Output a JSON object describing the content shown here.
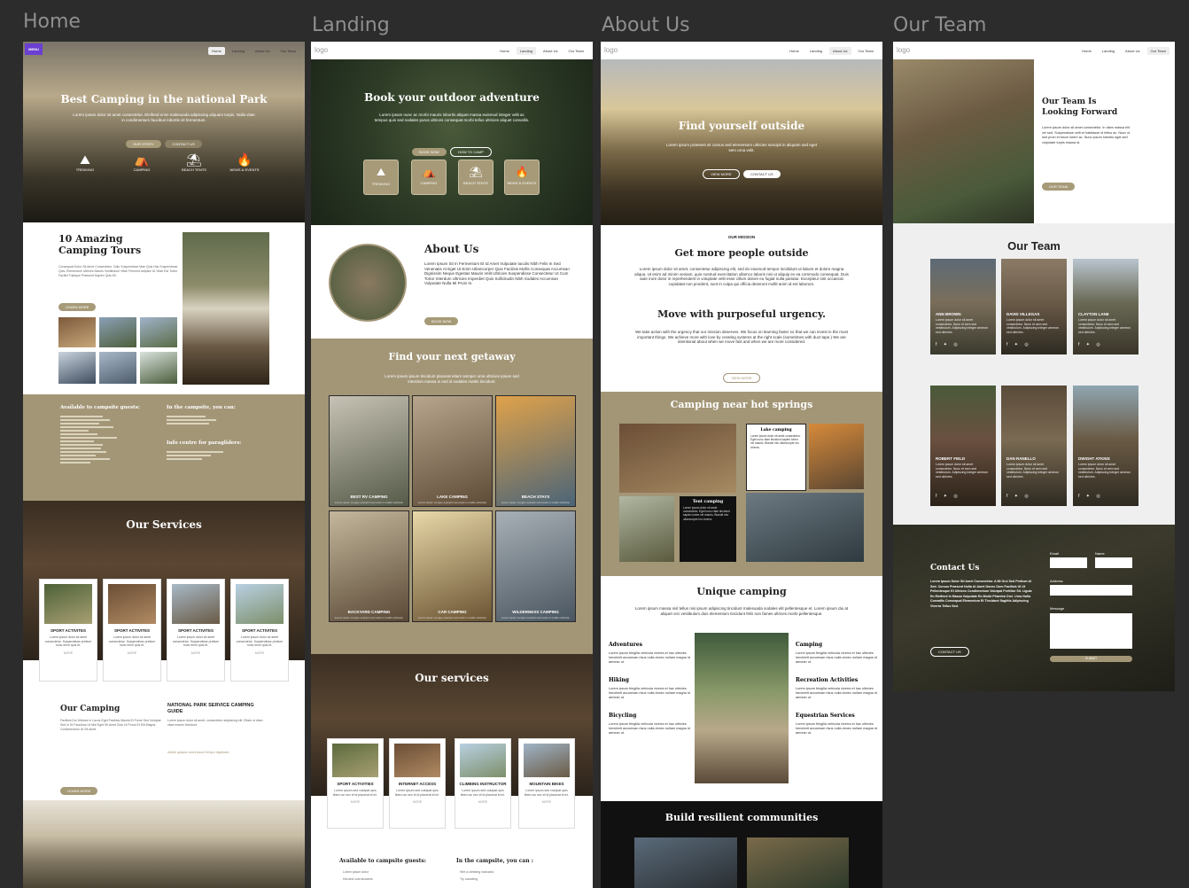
{
  "canvas": {
    "bg": "#2c2c2c",
    "olive": "#a39677",
    "dark": "#1f1f1f"
  },
  "frames": {
    "home": {
      "title": "Home",
      "logo": "MENU",
      "nav": [
        "Home",
        "Landing",
        "About Us",
        "Our Team"
      ],
      "hero_title": "Best Camping in the national Park",
      "hero_text": "Lorem ipsum dolor sit amet consectetur. Eleifend enim malesuada adipiscing aliquam turpis. Nulla vitae in condimentum faucibus lobortis sit fermentum.",
      "hero_btn1": "OUR STORY",
      "hero_btn2": "CONTACT US",
      "hero_icons": [
        {
          "icon": "mountain-icon",
          "label": "TREKKING"
        },
        {
          "icon": "tent-icon",
          "label": "CAMPING"
        },
        {
          "icon": "beach-icon",
          "label": "BEACH TENTS"
        },
        {
          "icon": "fire-icon",
          "label": "NEWS & EVENTS"
        }
      ],
      "tours_title": "10 Amazing Camping Tours",
      "tours_text": "Consequat Dolor Sit Amet Consectetur. Odio Suspendisse Mae Quis Hac Suspendisse Quis. Elementum Ultrices Mauris Vestibulum Vitae Ferment Adipisci Ut Vitae Est Tortor Facilisi Tristique Praesent Sapien Quis Mi.",
      "learn_more": "LEARN MORE",
      "guests_title": "Available to campsite guests:",
      "guests_items": [
        "Lorem ipsum dolor",
        "Hot and cold showers",
        "Kitchen facilities",
        "Barbecue area",
        "Laundry",
        "Drinking water",
        "Parking",
        "Wifi access",
        "Shop",
        "Games area",
        "Bike hire",
        "Picnic tables",
        "Night lighting",
        "Playground"
      ],
      "inthecamp_title": "In the campsite, you can:",
      "inthecamp_items": [
        "Hire a climbing instructor",
        "Go horse riding",
        "Try canoeing"
      ],
      "info_title": "Info centre for paragliders:",
      "info_items": [
        "Weather reports",
        "Flight routes",
        "Landing zones"
      ],
      "services_title": "Our Services",
      "service_cards": [
        {
          "title": "SPORT ACTIVITES",
          "text": "Lorem ipsum dolor sit amet consectetur. Suspendisse pretium nunc enim quis et.",
          "more": "MORE"
        },
        {
          "title": "SPORT ACTIVITES",
          "text": "Lorem ipsum dolor sit amet consectetur. Suspendisse pretium nunc enim quis et.",
          "more": "MORE"
        },
        {
          "title": "SPORT ACTIVITES",
          "text": "Lorem ipsum dolor sit amet consectetur. Suspendisse pretium nunc enim quis et.",
          "more": "MORE"
        },
        {
          "title": "SPORT ACTIVITES",
          "text": "Lorem ipsum dolor sit amet consectetur. Suspendisse pretium nunc enim quis et.",
          "more": "MORE"
        }
      ],
      "our_camping_title": "Our Camping",
      "our_camping_text": "Facilisis Dui Ultrices In Lacus Eget Facilisis Mauris Et Tortor Sed Volutpat Sed In Et Faucibus Ut Nisl Eget Sit Amet Duis Ut Purus Et Elit Magna Condimentum Ut Sit Amet.",
      "guide_title": "NATIONAL PARK SERVICE CAMPING GUIDE",
      "guide_text": "Lorem ipsum dolor sit amet, consectetur adipiscing elit. Etiam ut diam vitae mauris tincidunt.",
      "guide_highlight": "Article quisque amet ipsum tempor dignissim.",
      "learn_more2": "LEARN MORE"
    },
    "landing": {
      "title": "Landing",
      "logo": "logo",
      "nav": [
        "Home",
        "Landing",
        "About Us",
        "Our Team"
      ],
      "hero_title": "Book your outdoor adventure",
      "hero_text": "Lorem ipsum nunc ac morbi mauris lobortis aliquet massa euismod integer velit ac tempus quis sed sodales purus ultrices consequat morbi tellus ultricies aliquet convallis.",
      "btn1": "BOOK NOW",
      "btn2": "HOW TO CAMP",
      "icons": [
        {
          "icon": "mountain-icon",
          "label": "TREKKING"
        },
        {
          "icon": "tent-icon",
          "label": "CAMPING"
        },
        {
          "icon": "beach-icon",
          "label": "BEACH TENTS"
        },
        {
          "icon": "fire-icon",
          "label": "NEWS & EVENTS"
        }
      ],
      "about_title": "About Us",
      "about_text": "Lorem Ipsum Sit In Fermentum Et Id Amet Vulputate Iaculis Nibh Felis In Sed Venenatis At Eget Ut Enim Ullamcorper Quis Facilisis Mollis Consequat Accumsan Dignissim Neque Egestas Mauris Velit Ultricies Suspendisse Consectetur Ut Cum Tortor Interdum Ultricies Imperdiet Quis Sollicitudin Nibh Sodales Accumsan Vulputate Nulla Mi Proin In.",
      "about_btn": "BOOK NOW",
      "getaway_title": "Find your next getaway",
      "getaway_text": "Lorem ipsum ipsum tincidunt placerat etiam semper urna ultricies ipsum sed interdum massa in sed id sodales mattis tincidunt.",
      "getaway": [
        {
          "label": "BEST RV CAMPING",
          "sub": "Lorem ipsum congue suscipit commodo in mattis vehicula."
        },
        {
          "label": "LAKE CAMPING",
          "sub": "Lorem ipsum congue suscipit commodo in mattis vehicula."
        },
        {
          "label": "BEACH STAYS",
          "sub": "Lorem ipsum congue suscipit commodo in mattis vehicula."
        },
        {
          "label": "BACKYARD CAMPING",
          "sub": "Lorem ipsum congue suscipit commodo in mattis vehicula."
        },
        {
          "label": "CAR CAMPING",
          "sub": "Lorem ipsum congue suscipit commodo in mattis vehicula."
        },
        {
          "label": "WILDERNESS CAMPING",
          "sub": "Lorem ipsum congue suscipit commodo in mattis vehicula."
        }
      ],
      "services_title": "Our services",
      "service_cards": [
        {
          "title": "SPORT ACTIVITIES",
          "text": "Lorem ipsum sed volutpat quis libero ac nec et id placerat id mi.",
          "more": "MORE"
        },
        {
          "title": "INTERNET ACCESS",
          "text": "Lorem ipsum sed volutpat quis libero ac nec et id placerat id mi.",
          "more": "MORE"
        },
        {
          "title": "CLIMBING INSTRUCTOR",
          "text": "Lorem ipsum sed volutpat quis libero ac nec et id placerat id mi.",
          "more": "MORE"
        },
        {
          "title": "MOUNTAIN BIKES",
          "text": "Lorem ipsum sed volutpat quis libero ac nec et id placerat id mi.",
          "more": "MORE"
        }
      ],
      "avail_title": "Available to campsite guests:",
      "avail_items": [
        "Lorem ipsum dolor",
        "Hot and cold showers"
      ],
      "inthe_title": "In the campsite, you can :",
      "inthe_items": [
        "Hire a climbing instructor",
        "Try canoeing"
      ]
    },
    "about": {
      "title": "About Us",
      "logo": "logo",
      "nav": [
        "Home",
        "Landing",
        "About Us",
        "Our Team"
      ],
      "hero_title": "Find yourself outside",
      "hero_text": "Lorem ipsum praesent sit cursus sed elementum ultricies suscipit in aliquam sed eget sem urna velit.",
      "btn1": "VIEW MORE",
      "btn2": "CONTACT US",
      "mission_label": "OUR MISSION",
      "mission_title": "Get more people outside",
      "mission_text": "Lorem ipsum dolor sit amet, consectetur adipiscing elit, sed do eiusmod tempor incididunt ut labore et dolore magna aliqua. Ut enim ad minim veniam, quis nostrud exercitation ullamco laboris nisi ut aliquip ex ea commodo consequat. Duis aute irure dolor in reprehenderit in voluptate velit esse cillum dolore eu fugiat nulla pariatur. Excepteur sint occaecat cupidatat non proident, sunt in culpa qui officia deserunt mollit anim id est laborum.",
      "urgency_title": "Move with purposeful urgency.",
      "urgency_text": "We take action with the urgency that our mission deserves. We focus on learning faster so that we can invest in the most important things. We achieve more with love by creating systems at the right scale (sometimes with duct tape.) We are intentional about when we move fast and when we are more considered.",
      "view_more": "VIEW MORE",
      "springs_title": "Camping near hot springs",
      "lake_title": "Lake camping",
      "lake_text": "Lorem ipsum dolor sit amet consectetur. Eget nunc vitae tincidunt sapien lorem vel mauris. Blandit nec ullamcorper leo viverra.",
      "tent_title": "Tent camping",
      "tent_text": "Lorem ipsum dolor sit amet consectetur. Eget nunc vitae tincidunt sapien lorem vel mauris. Blandit nec ullamcorper leo viverra.",
      "unique_title": "Unique camping",
      "unique_text": "Lorem ipsum massa nisl tellus nisi ipsum adipiscing tincidunt malesuada sodales elit pellentesque et. Lorem ipsum dui at aliquet orci vestibulum duis elementum tincidunt felis non fames ultrices morbi pellentesque.",
      "left_items": [
        {
          "title": "Adventures",
          "text": "Lorem ipsum fringilla vehicula viverra et hac ultricies hendrerit accumsan risus nulla donec nullam magna id aenean ut."
        },
        {
          "title": "Hiking",
          "text": "Lorem ipsum fringilla vehicula viverra et hac ultricies hendrerit accumsan risus nulla donec nullam magna id aenean ut."
        },
        {
          "title": "Bicycling",
          "text": "Lorem ipsum fringilla vehicula viverra et hac ultricies hendrerit accumsan risus nulla donec nullam magna id aenean ut."
        }
      ],
      "right_items": [
        {
          "title": "Camping",
          "text": "Lorem ipsum fringilla vehicula viverra et hac ultricies hendrerit accumsan risus nulla donec nullam magna id aenean ut."
        },
        {
          "title": "Recreation Activities",
          "text": "Lorem ipsum fringilla vehicula viverra et hac ultricies hendrerit accumsan risus nulla donec nullam magna id aenean ut."
        },
        {
          "title": "Equestrian Services",
          "text": "Lorem ipsum fringilla vehicula viverra et hac ultricies hendrerit accumsan risus nulla donec nullam magna id aenean ut."
        }
      ],
      "build_title": "Build resilient communities"
    },
    "team": {
      "title": "Our Team",
      "logo": "logo",
      "nav": [
        "Home",
        "Landing",
        "About Us",
        "Our Team"
      ],
      "hero_title": "Our Team Is Looking Forward",
      "hero_text": "Lorem ipsum dolor sit amet consectetur. In diam massa elit vel sed. Suspendisse velit et habitasse id tellus ac. Nunc ut sed proin et fusce lorem ac. Nunc ipsum lobortis eget sed vulputate turpis massa id.",
      "hero_btn": "OUR TEAM",
      "section_title": "Our Team",
      "members": [
        {
          "name": "ANN BROWN",
          "text": "Lorem ipsum dolor sit amet consectetur. Nunc et sem sed vestibulum. Adipiscing integer aenean sed ultricies."
        },
        {
          "name": "DAVID VILLEGAS",
          "text": "Lorem ipsum dolor sit amet consectetur. Nunc et sem sed vestibulum. Adipiscing integer aenean sed ultricies."
        },
        {
          "name": "CLAYTON LANE",
          "text": "Lorem ipsum dolor sit amet consectetur. Nunc et sem sed vestibulum. Adipiscing integer aenean sed ultricies."
        },
        {
          "name": "ROBERT FIELD",
          "text": "Lorem ipsum dolor sit amet consectetur. Nunc et sem sed vestibulum. Adipiscing integer aenean sed ultricies."
        },
        {
          "name": "DAN RANELLO",
          "text": "Lorem ipsum dolor sit amet consectetur. Nunc et sem sed vestibulum. Adipiscing integer aenean sed ultricies."
        },
        {
          "name": "DWIGHT ATKINS",
          "text": "Lorem ipsum dolor sit amet consectetur. Nunc et sem sed vestibulum. Adipiscing integer aenean sed ultricies."
        }
      ],
      "social": "f ✦ ◎",
      "contact_title": "Contact Us",
      "contact_text": "Lorem Ipsum Dolor Sit Amet Consectetur. A Mi Orci Sed Pretium Id Sed. Cursus Praesent Nulla At Amet Donec Dum Facilisis Ut Ut Pellentesque Et Ultrices Condimentum Volutpat Porttitor Sit. Ligula Eu Eleifend In Massa Vulputate Eu Morbi Pharetra Orci. Urna Nulla Convallis Consequat Elementum Et Tincidunt Sagittis Adipiscing Viverra Tellus Sed.",
      "contact_btn": "CONTACT US",
      "email_label": "Email",
      "name_label": "Name",
      "address_label": "Address",
      "message_label": "Message",
      "submit_label": "SUBMIT"
    }
  }
}
